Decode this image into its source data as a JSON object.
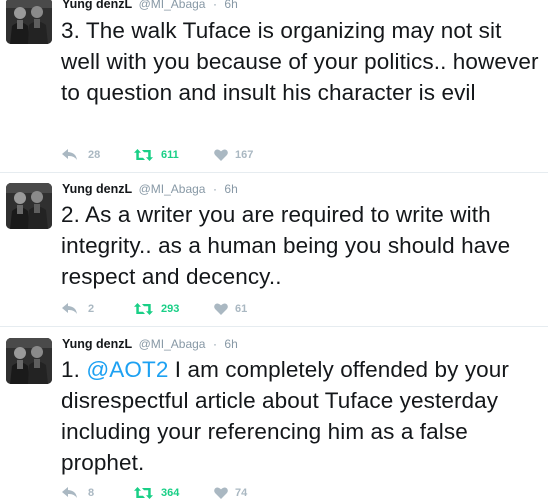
{
  "tweets": [
    {
      "fullname": "Yung denzL",
      "username": "@MI_Abaga",
      "separator": "·",
      "time": "6h",
      "text_parts": [
        "3. The walk Tuface is organizing may not sit well with you because of your politics.. however to question and insult his character is evil"
      ],
      "replies": "28",
      "retweets": "611",
      "likes": "167"
    },
    {
      "fullname": "Yung denzL",
      "username": "@MI_Abaga",
      "separator": "·",
      "time": "6h",
      "text_parts": [
        "2. As a writer you are required to write with integrity.. as a human being you should have respect and decency.."
      ],
      "replies": "2",
      "retweets": "293",
      "likes": "61"
    },
    {
      "fullname": "Yung denzL",
      "username": "@MI_Abaga",
      "separator": "·",
      "time": "6h",
      "text_prefix": "1. ",
      "mention": "@AOT2",
      "text_suffix": " I am completely offended by your disrespectful article about Tuface yesterday including your referencing him as a false prophet.",
      "replies": "8",
      "retweets": "364",
      "likes": "74"
    }
  ],
  "icons": {
    "reply": "reply-arrow-icon",
    "retweet": "retweet-icon",
    "like": "heart-icon"
  },
  "colors": {
    "text": "#14171a",
    "muted": "#8899a6",
    "action_grey": "#aab8c2",
    "retweet_green": "#19cf86",
    "mention_blue": "#1da1f2",
    "divider": "#e6ecf0"
  }
}
